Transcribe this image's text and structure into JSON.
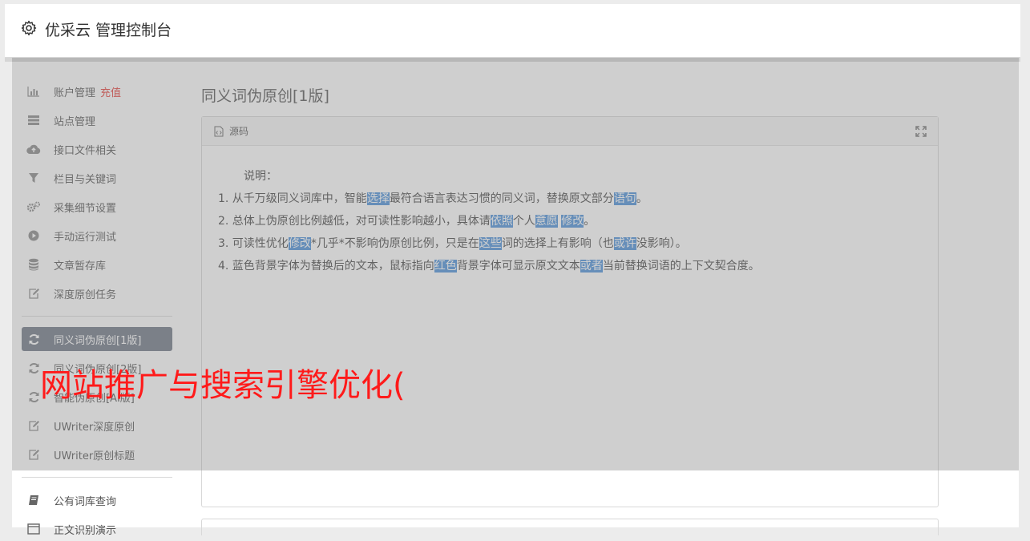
{
  "header": {
    "title": "优采云 管理控制台",
    "icon": "gear-icon"
  },
  "sidebar": {
    "items": [
      {
        "label": "账户管理",
        "badge": "充值",
        "icon": "bar-chart-icon"
      },
      {
        "label": "站点管理",
        "icon": "server-icon"
      },
      {
        "label": "接口文件相关",
        "icon": "cloud-upload-icon"
      },
      {
        "label": "栏目与关键词",
        "icon": "filter-icon"
      },
      {
        "label": "采集细节设置",
        "icon": "cogs-icon"
      },
      {
        "label": "手动运行测试",
        "icon": "play-circle-icon"
      },
      {
        "label": "文章暂存库",
        "icon": "database-icon"
      },
      {
        "label": "深度原创任务",
        "icon": "edit-icon"
      },
      {
        "label": "同义词伪原创[1版]",
        "icon": "refresh-icon",
        "active": true
      },
      {
        "label": "同义词伪原创[2版]",
        "icon": "refresh-icon"
      },
      {
        "label": "智能伪原创[AI版]",
        "icon": "refresh-icon"
      },
      {
        "label": "UWriter深度原创",
        "icon": "edit-icon"
      },
      {
        "label": "UWriter原创标题",
        "icon": "edit-icon"
      },
      {
        "label": "公有词库查询",
        "icon": "book-icon"
      },
      {
        "label": "正文识别演示",
        "icon": "window-icon"
      }
    ]
  },
  "main": {
    "page_title": "同义词伪原创[1版]",
    "panel": {
      "header_label": "源码",
      "note_label": "说明：",
      "lines": [
        [
          {
            "t": "1. 从千万级同义词库中，智能"
          },
          {
            "t": "选择",
            "hl": true
          },
          {
            "t": "最符合语言表达习惯的同义词，替换原文部分"
          },
          {
            "t": "语句",
            "hl": true
          },
          {
            "t": "。"
          }
        ],
        [
          {
            "t": "2. 总体上伪原创比例越低，对可读性影响越小，具体请"
          },
          {
            "t": "依照",
            "hl": true
          },
          {
            "t": "个人"
          },
          {
            "t": "意愿",
            "hl": true
          },
          {
            "t": " "
          },
          {
            "t": "修改",
            "hl": true
          },
          {
            "t": "。"
          }
        ],
        [
          {
            "t": "3. 可读性优化"
          },
          {
            "t": "修改",
            "hl": true
          },
          {
            "t": "*几乎*不影响伪原创比例，只是在"
          },
          {
            "t": "这些",
            "hl": true
          },
          {
            "t": "词的选择上有影响（也"
          },
          {
            "t": "或许",
            "hl": true
          },
          {
            "t": "没影响）。"
          }
        ],
        [
          {
            "t": "4. 蓝色背景字体为替换后的文本，鼠标指向"
          },
          {
            "t": "红色",
            "hl": true
          },
          {
            "t": "背景字体可显示原文文本"
          },
          {
            "t": "或者",
            "hl": true
          },
          {
            "t": "当前替换词语的上下文契合度。"
          }
        ]
      ]
    }
  },
  "watermark": "网站推广与搜索引擎优化(",
  "colors": {
    "active_nav": "#6f7785",
    "highlight": "#4a90d9",
    "recharge": "#e53935",
    "watermark": "#ff1a1a"
  }
}
